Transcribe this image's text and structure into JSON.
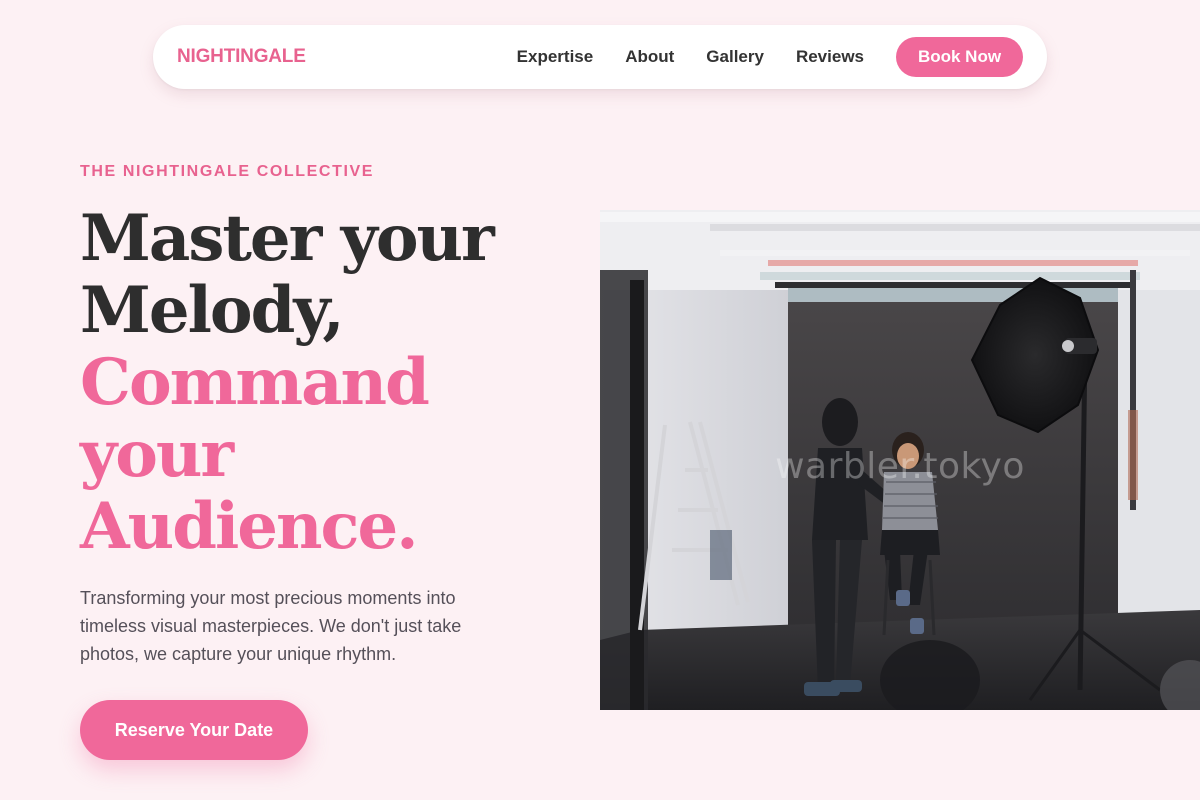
{
  "nav": {
    "logo": "NIGHTINGALE",
    "links": [
      "Expertise",
      "About",
      "Gallery",
      "Reviews"
    ],
    "cta": "Book Now"
  },
  "hero": {
    "eyebrow": "THE NIGHTINGALE COLLECTIVE",
    "headline_dark": [
      "Master your",
      "Melody,"
    ],
    "headline_pink": [
      "Command",
      "your",
      "Audience."
    ],
    "subtext": "Transforming your most precious moments into timeless visual masterpieces. We don't just take photos, we capture your unique rhythm.",
    "cta": "Reserve Your Date"
  },
  "photo": {
    "watermark": "warbler.tokyo",
    "description_icon": "photo-studio-image"
  },
  "colors": {
    "accent": "#f0689a",
    "background": "#fdf1f4",
    "text_dark": "#2e2e2e"
  }
}
